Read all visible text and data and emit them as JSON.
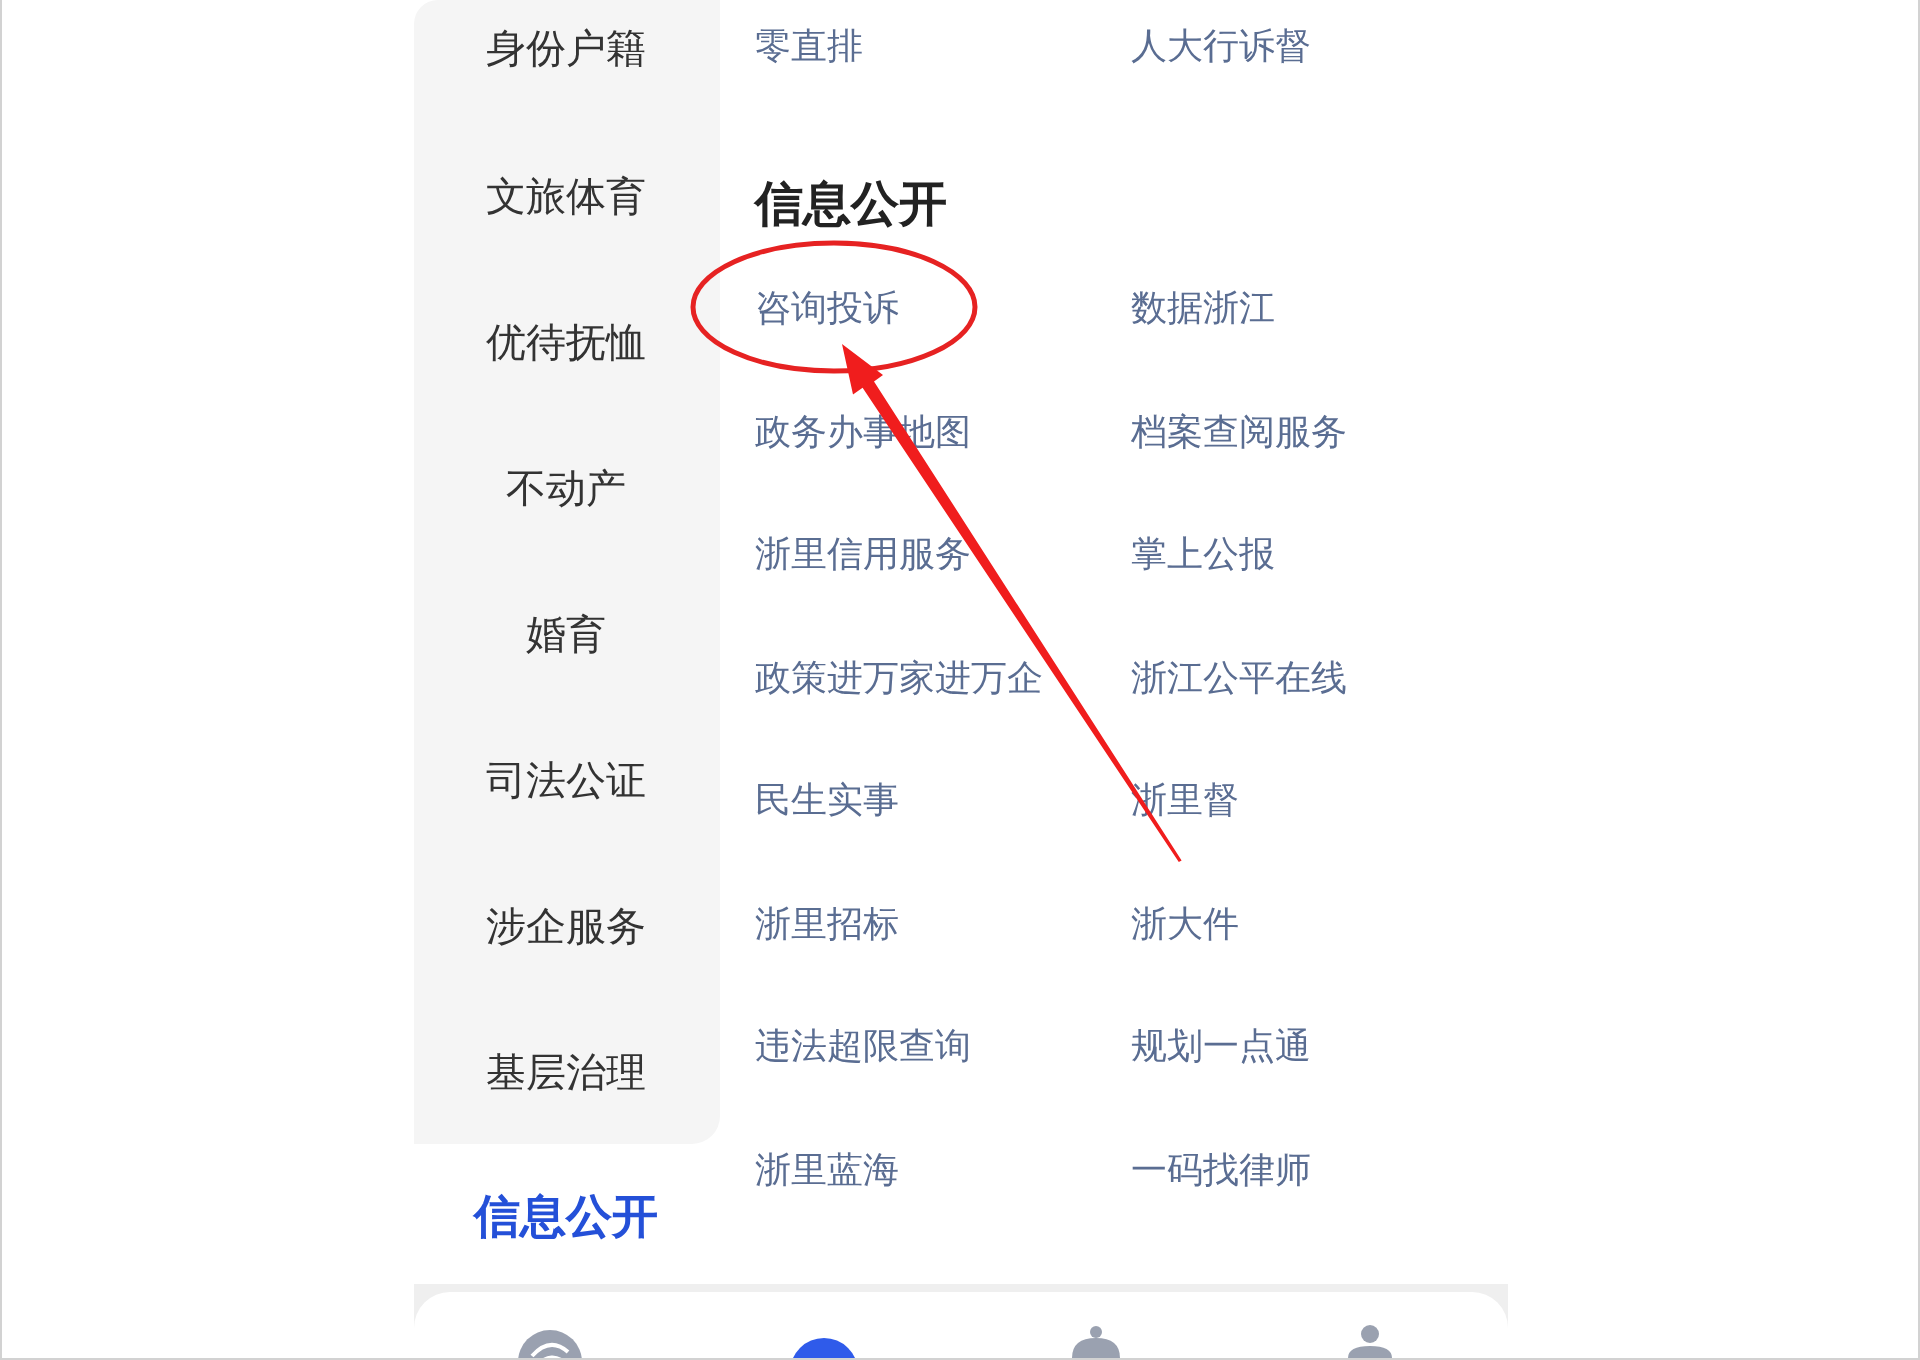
{
  "sidebar": {
    "items": [
      {
        "label": "身份户籍",
        "selected": false
      },
      {
        "label": "文旅体育",
        "selected": false
      },
      {
        "label": "优待抚恤",
        "selected": false
      },
      {
        "label": "不动产",
        "selected": false
      },
      {
        "label": "婚育",
        "selected": false
      },
      {
        "label": "司法公证",
        "selected": false
      },
      {
        "label": "涉企服务",
        "selected": false
      },
      {
        "label": "基层治理",
        "selected": false
      },
      {
        "label": "信息公开",
        "selected": true
      }
    ]
  },
  "content": {
    "sections": [
      {
        "links": [
          {
            "label": "零直排",
            "circled": false
          },
          {
            "label": "人大行诉督",
            "circled": false
          }
        ]
      },
      {
        "title": "信息公开",
        "links": [
          {
            "label": "咨询投诉",
            "circled": true
          },
          {
            "label": "数据浙江",
            "circled": false
          },
          {
            "label": "政务办事地图",
            "circled": false
          },
          {
            "label": "档案查阅服务",
            "circled": false
          },
          {
            "label": "浙里信用服务",
            "circled": false
          },
          {
            "label": "掌上公报",
            "circled": false
          },
          {
            "label": "政策进万家进万企",
            "circled": false
          },
          {
            "label": "浙江公平在线",
            "circled": false
          },
          {
            "label": "民生实事",
            "circled": false
          },
          {
            "label": "浙里督",
            "circled": false
          },
          {
            "label": "浙里招标",
            "circled": false
          },
          {
            "label": "浙大件",
            "circled": false
          },
          {
            "label": "违法超限查询",
            "circled": false
          },
          {
            "label": "规划一点通",
            "circled": false
          },
          {
            "label": "浙里蓝海",
            "circled": false
          },
          {
            "label": "一码找律师",
            "circled": false
          }
        ]
      }
    ]
  },
  "bottom_nav": {
    "tabs": [
      {
        "selected": false
      },
      {
        "selected": true
      },
      {
        "selected": false
      },
      {
        "selected": false
      }
    ]
  }
}
